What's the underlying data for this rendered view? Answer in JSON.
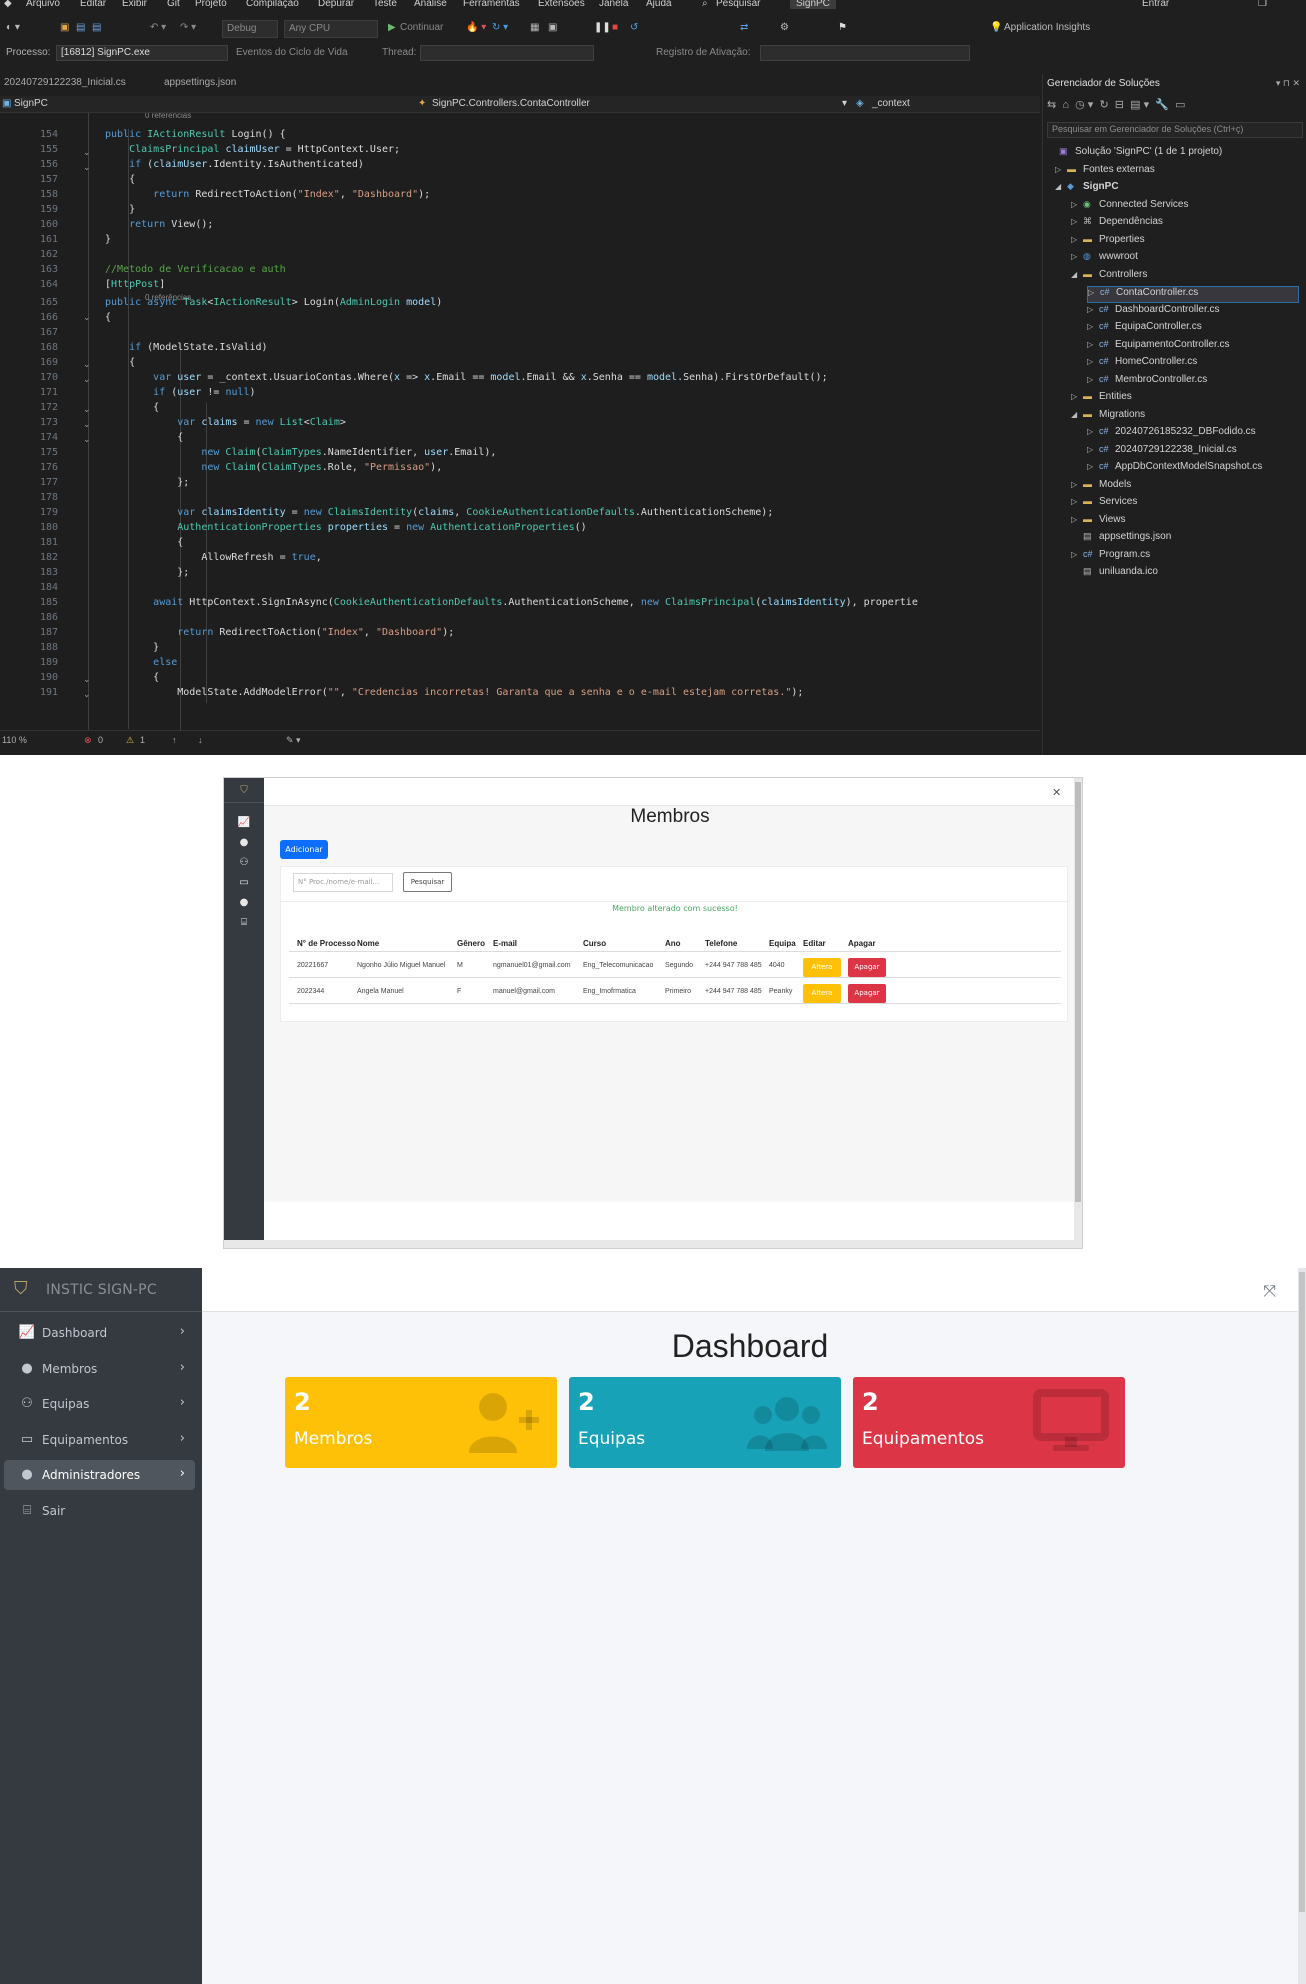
{
  "ide": {
    "menu": [
      "Arquivo",
      "Editar",
      "Exibir",
      "Git",
      "Projeto",
      "Compilação",
      "Depurar",
      "Teste",
      "Análise",
      "Ferramentas",
      "Extensões",
      "Janela",
      "Ajuda"
    ],
    "search_label": "Pesquisar",
    "solution_badge": "SignPC",
    "signin": "Entrar",
    "toolbar": {
      "config": "Debug",
      "platform": "Any CPU",
      "continue": "Continuar",
      "app_insights": "Application Insights"
    },
    "toolbar2": {
      "process_label": "Processo:",
      "process_value": "[16812] SignPC.exe",
      "lifecycle": "Eventos do Ciclo de Vida",
      "thread": "Thread:",
      "stack": "Registro de Ativação:"
    },
    "doc_tabs": [
      "20240729122238_Inicial.cs",
      "appsettings.json"
    ],
    "nav": {
      "project": "SignPC",
      "class": "SignPC.Controllers.ContaController",
      "member": "_context"
    },
    "references_hint": "0 referências",
    "statusbar": {
      "zoom": "110 %",
      "errors": "0",
      "warnings": "1"
    },
    "solution_explorer": {
      "title": "Gerenciador de Soluções",
      "search_placeholder": "Pesquisar em Gerenciador de Soluções (Ctrl+ç)",
      "nodes": [
        {
          "label": "Solução 'SignPC' (1 de 1 projeto)",
          "icon": "solution"
        },
        {
          "label": "Fontes externas",
          "icon": "folder"
        },
        {
          "label": "SignPC",
          "icon": "project"
        },
        {
          "label": "Connected Services",
          "icon": "services"
        },
        {
          "label": "Dependências",
          "icon": "deps"
        },
        {
          "label": "Properties",
          "icon": "folder"
        },
        {
          "label": "wwwroot",
          "icon": "globe"
        },
        {
          "label": "Controllers",
          "icon": "folder"
        },
        {
          "label": "ContaController.cs",
          "icon": "C#"
        },
        {
          "label": "DashboardController.cs",
          "icon": "C#"
        },
        {
          "label": "EquipaController.cs",
          "icon": "C#"
        },
        {
          "label": "EquipamentoController.cs",
          "icon": "C#"
        },
        {
          "label": "HomeController.cs",
          "icon": "C#"
        },
        {
          "label": "MembroController.cs",
          "icon": "C#"
        },
        {
          "label": "Entities",
          "icon": "folder"
        },
        {
          "label": "Migrations",
          "icon": "folder"
        },
        {
          "label": "20240726185232_DBFodido.cs",
          "icon": "C#"
        },
        {
          "label": "20240729122238_Inicial.cs",
          "icon": "C#"
        },
        {
          "label": "AppDbContextModelSnapshot.cs",
          "icon": "C#"
        },
        {
          "label": "Models",
          "icon": "folder"
        },
        {
          "label": "Services",
          "icon": "folder"
        },
        {
          "label": "Views",
          "icon": "folder"
        },
        {
          "label": "appsettings.json",
          "icon": "file"
        },
        {
          "label": "Program.cs",
          "icon": "C#"
        },
        {
          "label": "uniluanda.ico",
          "icon": "file"
        }
      ]
    },
    "code_lines": [
      {
        "n": "154",
        "t": "public IActionResult Login() {"
      },
      {
        "n": "155",
        "t": "    ClaimsPrincipal claimUser = HttpContext.User;"
      },
      {
        "n": "156",
        "t": "    if (claimUser.Identity.IsAuthenticated)"
      },
      {
        "n": "157",
        "t": "    {"
      },
      {
        "n": "158",
        "t": "        return RedirectToAction(\"Index\", \"Dashboard\");"
      },
      {
        "n": "159",
        "t": "    }"
      },
      {
        "n": "160",
        "t": "    return View();"
      },
      {
        "n": "161",
        "t": "}"
      },
      {
        "n": "162",
        "t": ""
      },
      {
        "n": "163",
        "t": "//Metodo de Verificacao e auth"
      },
      {
        "n": "164",
        "t": "[HttpPost]"
      },
      {
        "n": "165",
        "t": "public async Task<IActionResult> Login(AdminLogin model)"
      },
      {
        "n": "166",
        "t": "{"
      },
      {
        "n": "167",
        "t": ""
      },
      {
        "n": "168",
        "t": "    if (ModelState.IsValid)"
      },
      {
        "n": "169",
        "t": "    {"
      },
      {
        "n": "170",
        "t": "        var user = _context.UsuarioContas.Where(x => x.Email == model.Email && x.Senha == model.Senha).FirstOrDefault();"
      },
      {
        "n": "171",
        "t": "        if (user != null)"
      },
      {
        "n": "172",
        "t": "        {"
      },
      {
        "n": "173",
        "t": "            var claims = new List<Claim>"
      },
      {
        "n": "174",
        "t": "            {"
      },
      {
        "n": "175",
        "t": "                new Claim(ClaimTypes.NameIdentifier, user.Email),"
      },
      {
        "n": "176",
        "t": "                new Claim(ClaimTypes.Role, \"Permissao\"),"
      },
      {
        "n": "177",
        "t": "            };"
      },
      {
        "n": "178",
        "t": ""
      },
      {
        "n": "179",
        "t": "            var claimsIdentity = new ClaimsIdentity(claims, CookieAuthenticationDefaults.AuthenticationScheme);"
      },
      {
        "n": "180",
        "t": "            AuthenticationProperties properties = new AuthenticationProperties()"
      },
      {
        "n": "181",
        "t": "            {"
      },
      {
        "n": "182",
        "t": "                AllowRefresh = true,"
      },
      {
        "n": "183",
        "t": "            };"
      },
      {
        "n": "184",
        "t": ""
      },
      {
        "n": "185",
        "t": "        await HttpContext.SignInAsync(CookieAuthenticationDefaults.AuthenticationScheme, new ClaimsPrincipal(claimsIdentity), propertie"
      },
      {
        "n": "186",
        "t": ""
      },
      {
        "n": "187",
        "t": "            return RedirectToAction(\"Index\", \"Dashboard\");"
      },
      {
        "n": "188",
        "t": "        }"
      },
      {
        "n": "189",
        "t": "        else"
      },
      {
        "n": "190",
        "t": "        {"
      },
      {
        "n": "191",
        "t": "            ModelState.AddModelError(\"\", \"Credencias incorretas! Garanta que a senha e o e-mail estejam corretas.\");"
      }
    ]
  },
  "membros": {
    "title": "Membros",
    "add_button": "Adicionar",
    "search_placeholder": "N° Proc./nome/e-mail...",
    "search_button": "Pesquisar",
    "success_message": "Membro alterado com sucesso!",
    "columns": [
      "N° de Processo",
      "Nome",
      "Gênero",
      "E-mail",
      "Curso",
      "Ano",
      "Telefone",
      "Equipa",
      "Editar",
      "Apagar"
    ],
    "rows": [
      {
        "processo": "20221667",
        "nome": "Ngonho Júlio Miguel Manuel",
        "genero": "M",
        "email": "ngmanuel01@gmail.com",
        "curso": "Eng_Telecomunicacao",
        "ano": "Segundo",
        "telefone": "+244 947 788 485",
        "equipa": "4040",
        "editar": "Altera",
        "apagar": "Apagar"
      },
      {
        "processo": "2022344",
        "nome": "Angela Manuel",
        "genero": "F",
        "email": "manuel@gmail.com",
        "curso": "Eng_Imofrmatica",
        "ano": "Primeiro",
        "telefone": "+244 947 788 485",
        "equipa": "Peanky",
        "editar": "Altera",
        "apagar": "Apagar"
      }
    ]
  },
  "dashboard": {
    "brand": "INSTIC SIGN-PC",
    "title": "Dashboard",
    "nav": [
      {
        "label": "Dashboard",
        "icon": "chart-icon"
      },
      {
        "label": "Membros",
        "icon": "user-icon"
      },
      {
        "label": "Equipas",
        "icon": "users-icon"
      },
      {
        "label": "Equipamentos",
        "icon": "monitor-icon"
      },
      {
        "label": "Administradores",
        "icon": "user-icon"
      },
      {
        "label": "Sair",
        "icon": "door-icon"
      }
    ],
    "cards": [
      {
        "count": "2",
        "label": "Membros",
        "color": "#ffc107",
        "icon": "user-plus-icon"
      },
      {
        "count": "2",
        "label": "Equipas",
        "color": "#17a2b8",
        "icon": "users-icon"
      },
      {
        "count": "2",
        "label": "Equipamentos",
        "color": "#dc3545",
        "icon": "monitor-icon"
      }
    ]
  }
}
